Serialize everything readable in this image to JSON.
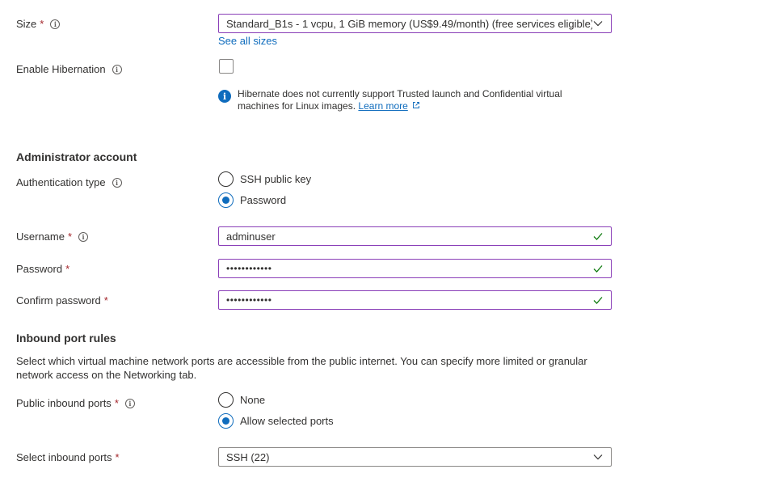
{
  "size": {
    "label": "Size",
    "required": "*",
    "value": "Standard_B1s - 1 vcpu, 1 GiB memory (US$9.49/month)  (free services eligible)",
    "see_all": "See all sizes"
  },
  "hibernation": {
    "label": "Enable Hibernation",
    "checked": false,
    "info_text": "Hibernate does not currently support Trusted launch and Confidential virtual machines for Linux images.",
    "learn_more": "Learn more"
  },
  "admin": {
    "heading": "Administrator account",
    "auth_label": "Authentication type",
    "auth_options": [
      "SSH public key",
      "Password"
    ],
    "auth_selected": "Password",
    "username_label": "Username",
    "username_value": "adminuser",
    "password_label": "Password",
    "password_value": "••••••••••••",
    "confirm_label": "Confirm password",
    "confirm_value": "••••••••••••"
  },
  "inbound": {
    "heading": "Inbound port rules",
    "description": "Select which virtual machine network ports are accessible from the public internet. You can specify more limited or granular network access on the Networking tab.",
    "public_label": "Public inbound ports",
    "public_options": [
      "None",
      "Allow selected ports"
    ],
    "public_selected": "Allow selected ports",
    "select_label": "Select inbound ports",
    "select_value": "SSH (22)"
  },
  "colors": {
    "accent": "#0f6cbd",
    "valid_border": "#8a3fb8",
    "check": "#107c10",
    "required": "#a4262c"
  },
  "req": "*"
}
